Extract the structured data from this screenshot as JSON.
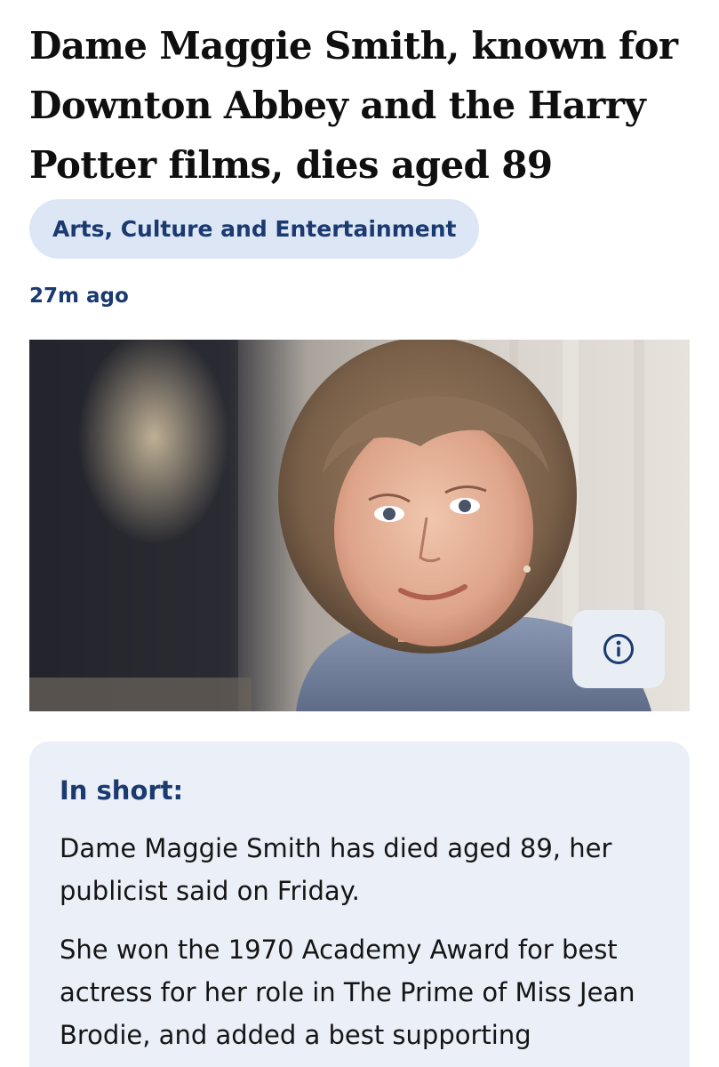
{
  "article": {
    "headline": "Dame Maggie Smith, known for Downton Abbey and the Harry Potter films, dies aged 89",
    "topic_chip": "Arts, Culture and Entertainment",
    "published": "27m ago"
  },
  "hero_image": {
    "info_icon": "info-circle-icon"
  },
  "in_short": {
    "heading": "In short:",
    "paragraphs": [
      "Dame Maggie Smith has died aged 89, her publicist said on Friday.",
      "She won the 1970 Academy Award for best actress for her role in The Prime of Miss Jean Brodie, and added a best supporting"
    ]
  },
  "colors": {
    "accent_navy": "#1a3a70",
    "chip_background": "#dde6f5",
    "summary_background": "#eaeff8"
  }
}
